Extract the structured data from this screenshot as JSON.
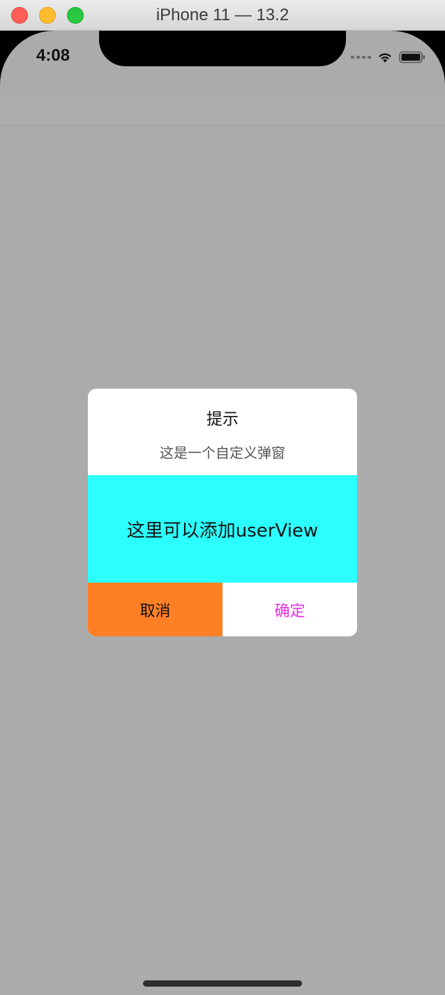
{
  "window": {
    "title": "iPhone 11 — 13.2"
  },
  "status_bar": {
    "time": "4:08"
  },
  "dialog": {
    "title": "提示",
    "message": "这是一个自定义弹窗",
    "user_view_text": "这里可以添加userView",
    "cancel_label": "取消",
    "confirm_label": "确定",
    "colors": {
      "user_view_bg": "#2cffff",
      "cancel_bg": "#ff7f24",
      "confirm_text": "#e62ee6"
    }
  },
  "icons": {
    "signal": "cellular-signal-icon",
    "wifi": "wifi-icon",
    "battery": "battery-icon"
  }
}
